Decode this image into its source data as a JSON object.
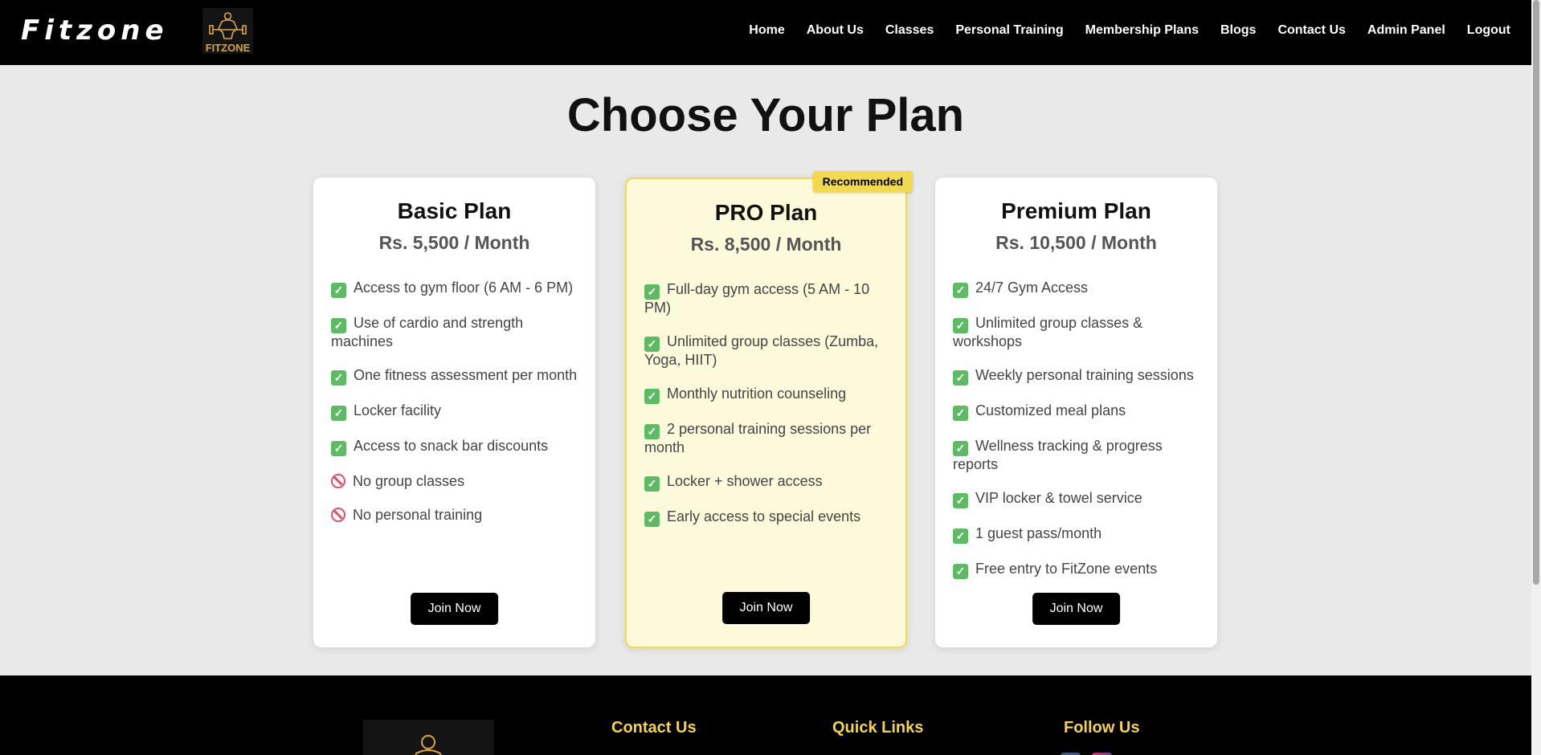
{
  "header": {
    "brand": "Fitzone",
    "logo_text": "FITZONE",
    "nav": [
      "Home",
      "About Us",
      "Classes",
      "Personal Training",
      "Membership Plans",
      "Blogs",
      "Contact Us",
      "Admin Panel",
      "Logout"
    ]
  },
  "main": {
    "title": "Choose Your Plan",
    "plans": [
      {
        "name": "Basic Plan",
        "price": "Rs. 5,500 / Month",
        "features": [
          {
            "icon": "check-icon",
            "text": "Access to gym floor (6 AM - 6 PM)"
          },
          {
            "icon": "check-icon",
            "text": "Use of cardio and strength machines"
          },
          {
            "icon": "check-icon",
            "text": "One fitness assessment per month"
          },
          {
            "icon": "check-icon",
            "text": "Locker facility"
          },
          {
            "icon": "check-icon",
            "text": "Access to snack bar discounts"
          },
          {
            "icon": "prohibited-icon",
            "text": "No group classes"
          },
          {
            "icon": "prohibited-icon",
            "text": "No personal training"
          }
        ],
        "button": "Join Now"
      },
      {
        "name": "PRO Plan",
        "price": "Rs. 8,500 / Month",
        "badge": "Recommended",
        "features": [
          {
            "icon": "check-icon",
            "text": "Full-day gym access (5 AM - 10 PM)"
          },
          {
            "icon": "check-icon",
            "text": "Unlimited group classes (Zumba, Yoga, HIIT)"
          },
          {
            "icon": "check-icon",
            "text": "Monthly nutrition counseling"
          },
          {
            "icon": "check-icon",
            "text": "2 personal training sessions per month"
          },
          {
            "icon": "check-icon",
            "text": "Locker + shower access"
          },
          {
            "icon": "check-icon",
            "text": "Early access to special events"
          }
        ],
        "button": "Join Now"
      },
      {
        "name": "Premium Plan",
        "price": "Rs. 10,500 / Month",
        "features": [
          {
            "icon": "check-icon",
            "text": "24/7 Gym Access"
          },
          {
            "icon": "check-icon",
            "text": "Unlimited group classes & workshops"
          },
          {
            "icon": "check-icon",
            "text": "Weekly personal training sessions"
          },
          {
            "icon": "check-icon",
            "text": "Customized meal plans"
          },
          {
            "icon": "check-icon",
            "text": "Wellness tracking & progress reports"
          },
          {
            "icon": "check-icon",
            "text": "VIP locker & towel service"
          },
          {
            "icon": "check-icon",
            "text": "1 guest pass/month"
          },
          {
            "icon": "check-icon",
            "text": "Free entry to FitZone events"
          }
        ],
        "button": "Join Now"
      }
    ]
  },
  "footer": {
    "headings": [
      "Contact Us",
      "Quick Links",
      "Follow Us"
    ]
  },
  "colors": {
    "accent_yellow": "#f2d94e",
    "footer_heading": "#f5d547",
    "check_green": "#5dbb63",
    "prohibited_red": "#e0526a"
  }
}
